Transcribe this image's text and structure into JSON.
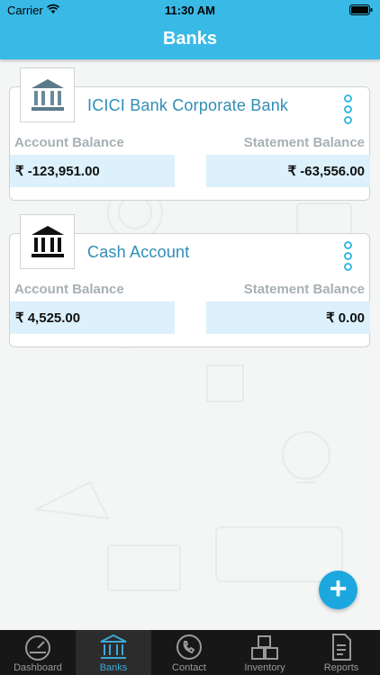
{
  "status_bar": {
    "carrier": "Carrier",
    "time": "11:30 AM"
  },
  "header": {
    "title": "Banks"
  },
  "banks": [
    {
      "name": "ICICI Bank Corporate Bank",
      "account_balance_label": "Account Balance",
      "statement_balance_label": "Statement Balance",
      "account_balance": "₹ -123,951.00",
      "statement_balance": "₹ -63,556.00"
    },
    {
      "name": "Cash Account",
      "account_balance_label": "Account Balance",
      "statement_balance_label": "Statement Balance",
      "account_balance": "₹ 4,525.00",
      "statement_balance": "₹ 0.00"
    }
  ],
  "fab": {
    "label": "+"
  },
  "tabs": [
    {
      "label": "Dashboard",
      "icon": "speedometer-icon"
    },
    {
      "label": "Banks",
      "icon": "bank-icon"
    },
    {
      "label": "Contact",
      "icon": "phone-icon"
    },
    {
      "label": "Inventory",
      "icon": "boxes-icon"
    },
    {
      "label": "Reports",
      "icon": "document-icon"
    }
  ],
  "colors": {
    "accent": "#39b9e6",
    "amount_bg": "#dcf1fb",
    "tab_active": "#3aa9d9"
  }
}
